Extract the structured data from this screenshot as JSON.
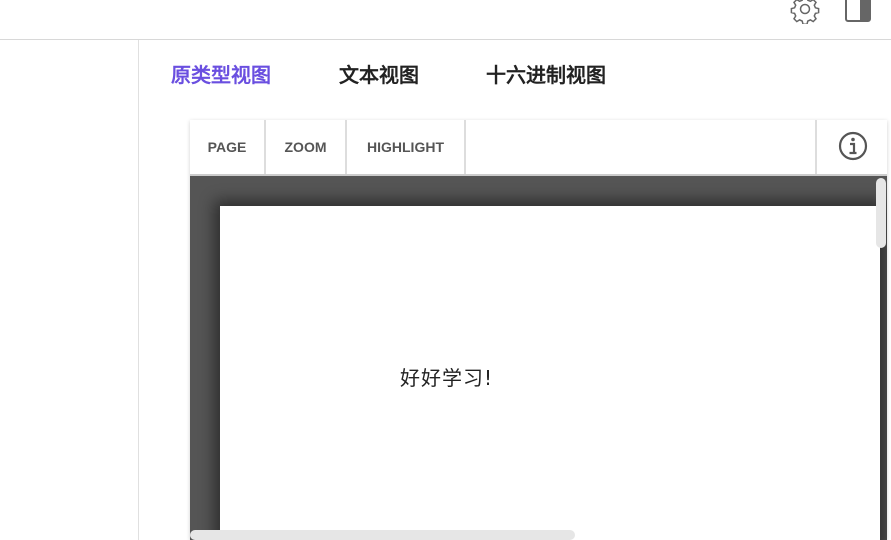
{
  "header": {
    "settings_icon": "gear-icon",
    "panel_icon": "sidebar-panel-icon"
  },
  "view_tabs": [
    {
      "label": "原类型视图",
      "active": true
    },
    {
      "label": "文本视图",
      "active": false
    },
    {
      "label": "十六进制视图",
      "active": false
    }
  ],
  "toolbar": {
    "buttons": [
      "PAGE",
      "ZOOM",
      "HIGHLIGHT"
    ],
    "info_icon": "info-icon"
  },
  "document": {
    "text": "好好学习!"
  },
  "colors": {
    "accent": "#6a4fe0",
    "canvas_bg": "#555555",
    "page_bg": "#ffffff"
  }
}
